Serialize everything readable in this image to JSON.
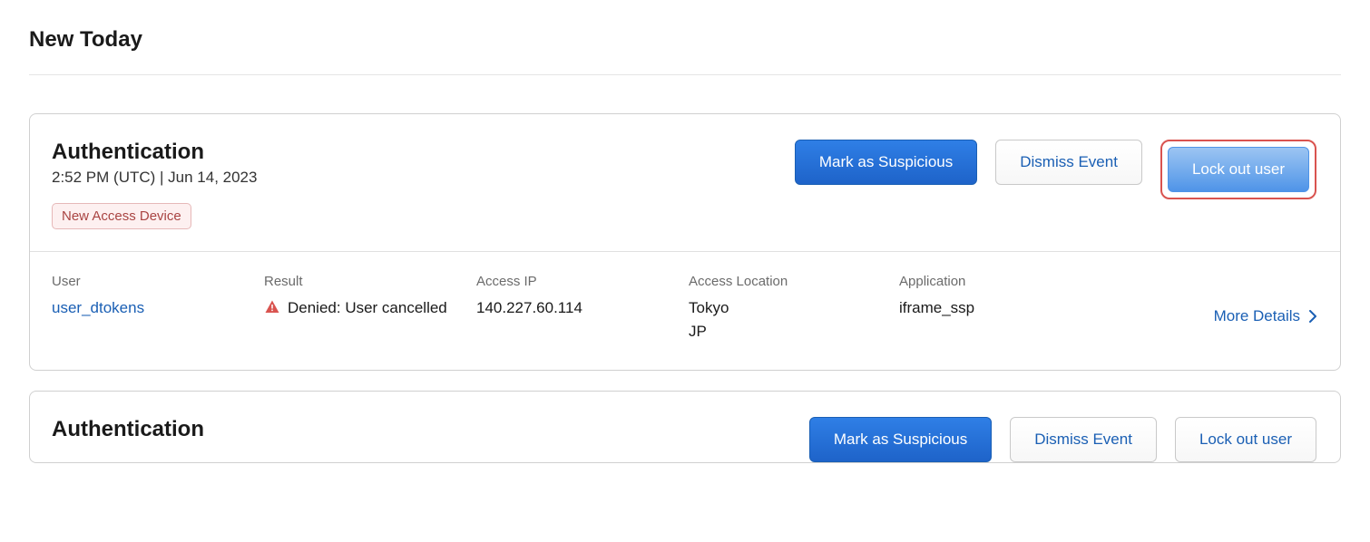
{
  "section_title": "New Today",
  "events": [
    {
      "title": "Authentication",
      "timestamp": "2:52 PM (UTC) | Jun 14, 2023",
      "tag": "New Access Device",
      "actions": {
        "mark_suspicious": "Mark as Suspicious",
        "dismiss": "Dismiss Event",
        "lockout": "Lock out user"
      },
      "highlight_lockout": true,
      "details": {
        "user_label": "User",
        "user_value": "user_dtokens",
        "result_label": "Result",
        "result_value": "Denied: User cancelled",
        "ip_label": "Access IP",
        "ip_value": "140.227.60.114",
        "location_label": "Access Location",
        "location_line1": "Tokyo",
        "location_line2": "JP",
        "app_label": "Application",
        "app_value": "iframe_ssp",
        "more_details": "More Details"
      }
    },
    {
      "title": "Authentication",
      "actions": {
        "mark_suspicious": "Mark as Suspicious",
        "dismiss": "Dismiss Event",
        "lockout": "Lock out user"
      },
      "highlight_lockout": false
    }
  ]
}
